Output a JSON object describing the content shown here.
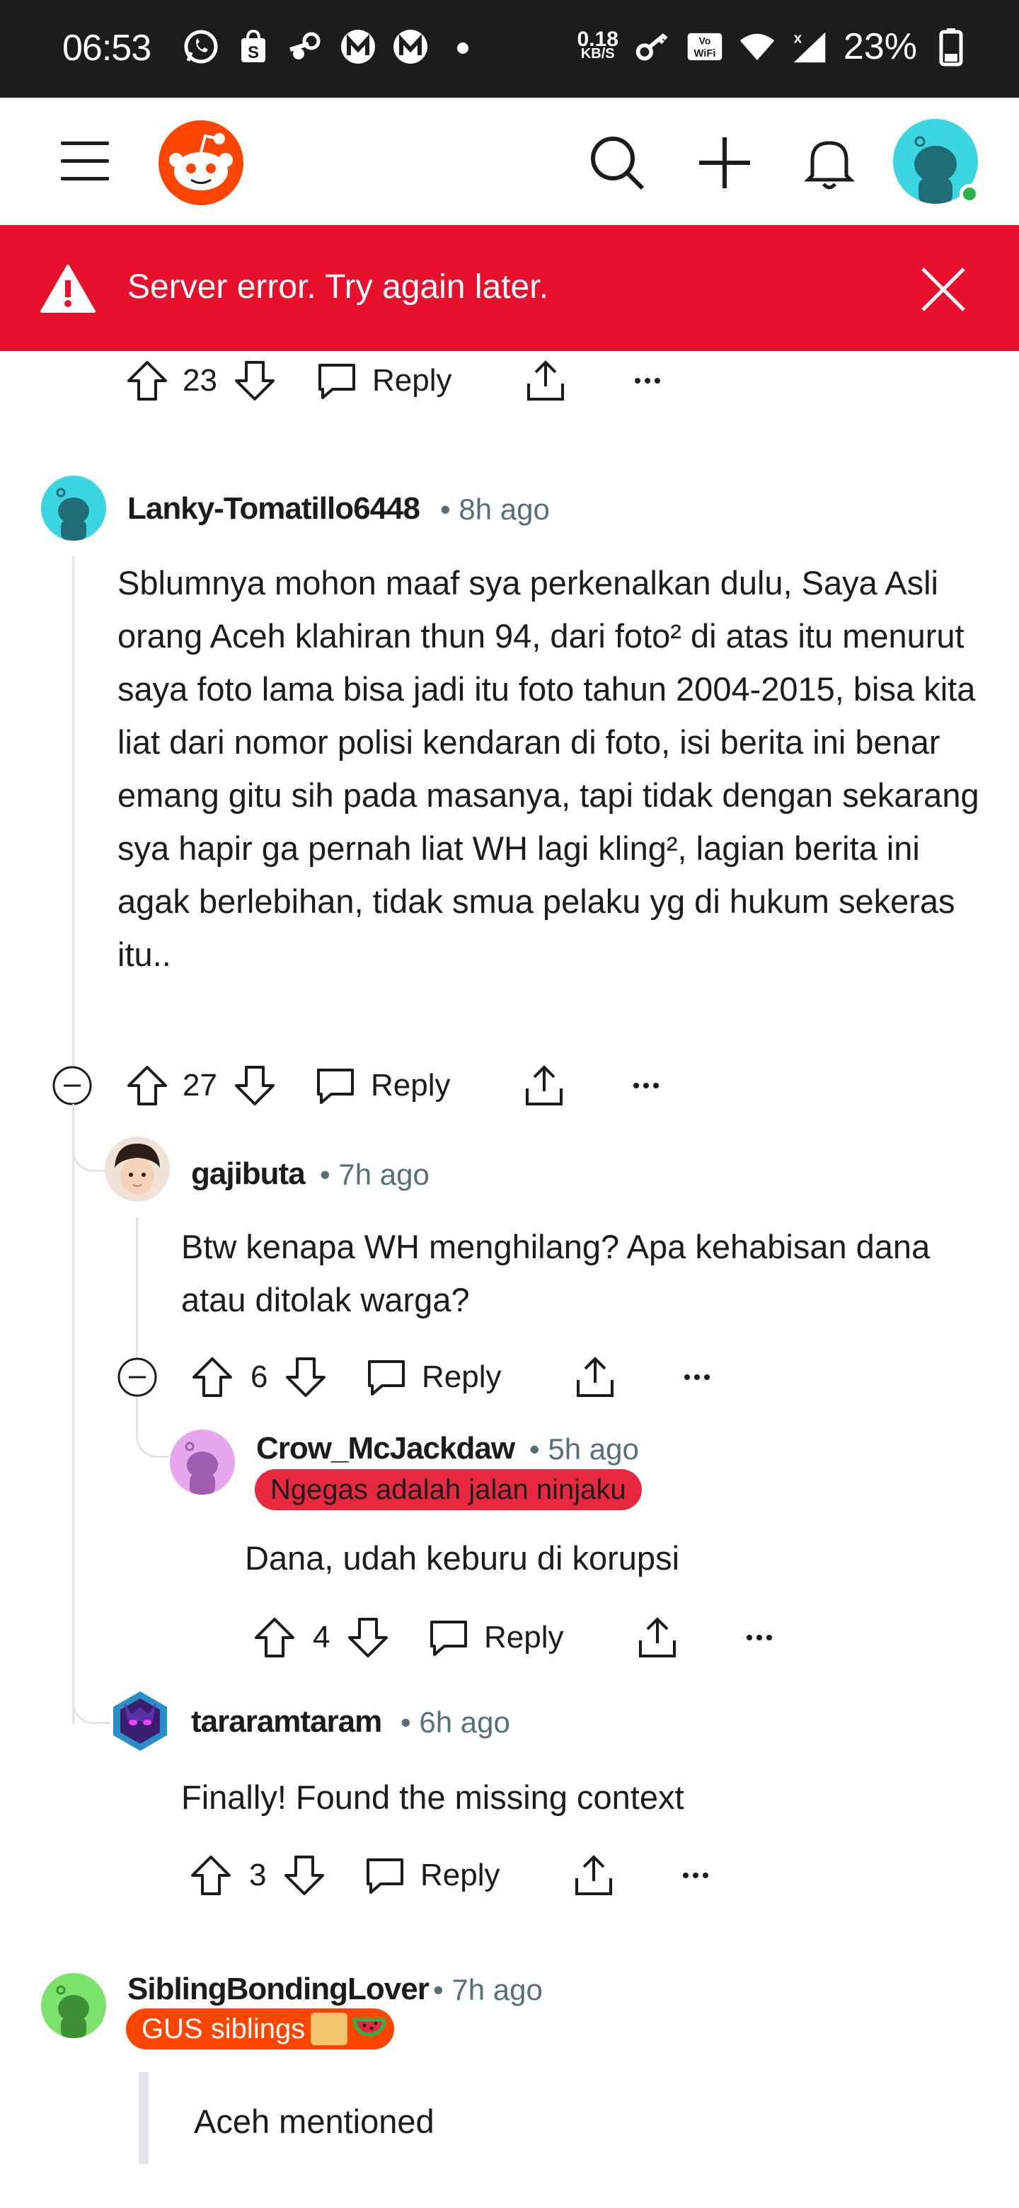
{
  "status_bar": {
    "time": "06:53",
    "speed_value": "0.18",
    "speed_unit": "KB/S",
    "vowifi": "Vo WiFi",
    "battery": "23%",
    "icons": [
      "whatsapp-icon",
      "shopping-bag-icon",
      "steam-icon",
      "m-app-icon",
      "m-app-icon",
      "dot-icon",
      "key-icon",
      "wifi-icon",
      "signal-icon",
      "battery-icon"
    ]
  },
  "header": {
    "icons": [
      "menu-icon",
      "reddit-logo",
      "search-icon",
      "plus-icon",
      "bell-icon",
      "avatar"
    ]
  },
  "error_banner": {
    "message": "Server error. Try again later.",
    "color": "#e8112d"
  },
  "top_actions": {
    "votes": "23",
    "reply_label": "Reply"
  },
  "comments": [
    {
      "username": "Lanky-Tomatillo6448",
      "time": "• 8h ago",
      "body": "Sblumnya mohon maaf sya perkenalkan dulu, Saya Asli orang Aceh klahiran thun 94, dari foto² di atas itu menurut saya foto lama bisa jadi itu foto tahun 2004-2015, bisa kita liat dari nomor polisi kendaran di foto, isi berita ini benar emang gitu sih pada masanya, tapi tidak dengan sekarang sya hapir ga pernah liat WH lagi kling², lagian berita ini agak berlebihan, tidak smua pelaku yg di hukum sekeras itu..",
      "votes": "27",
      "reply_label": "Reply"
    },
    {
      "username": "gajibuta",
      "time": "• 7h ago",
      "body": "Btw kenapa WH menghilang? Apa kehabisan dana atau ditolak warga?",
      "votes": "6",
      "reply_label": "Reply"
    },
    {
      "username": "Crow_McJackdaw",
      "time": "• 5h ago",
      "flair": "Ngegas adalah jalan ninjaku",
      "flair_color": "#e8283f",
      "body": "Dana, udah keburu di korupsi",
      "votes": "4",
      "reply_label": "Reply"
    },
    {
      "username": "tararamtaram",
      "time": "• 6h ago",
      "body": "Finally! Found the missing context",
      "votes": "3",
      "reply_label": "Reply"
    },
    {
      "username": "SiblingBondingLover",
      "time": "• 7h ago",
      "flair": "GUS siblings",
      "flair_color": "#ff4500",
      "body": "Aceh mentioned"
    }
  ]
}
